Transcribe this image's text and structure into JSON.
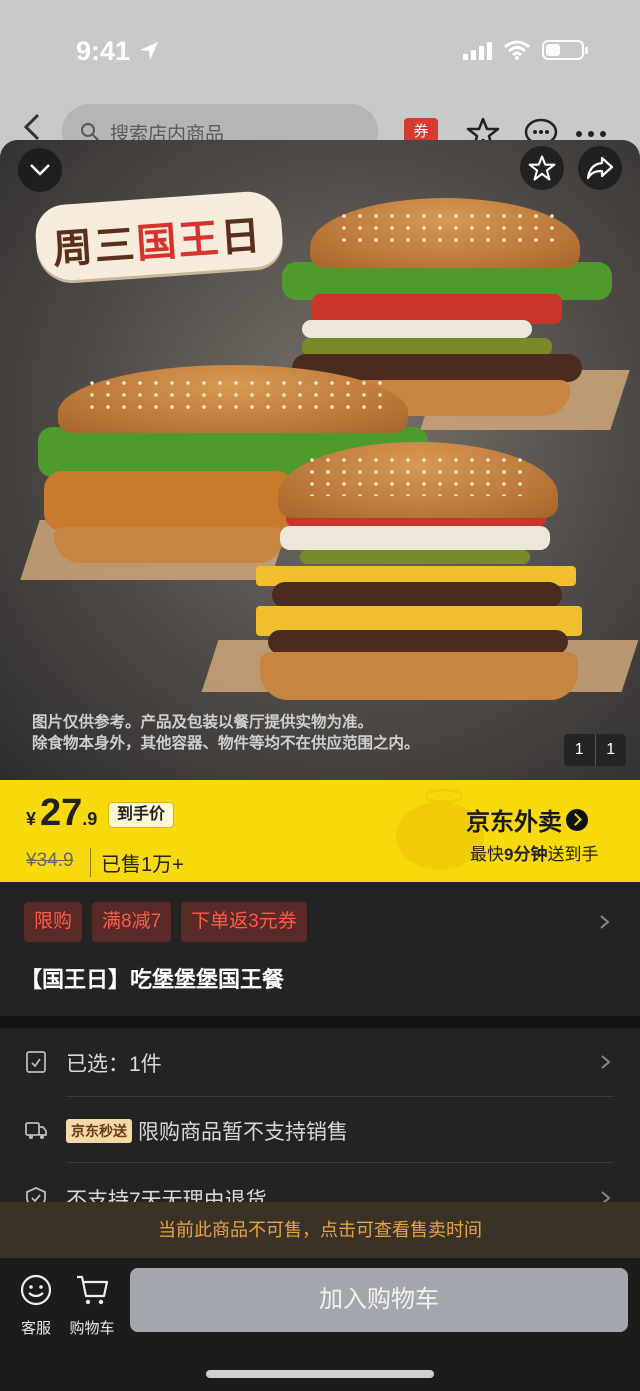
{
  "status_bar": {
    "time": "9:41"
  },
  "header": {
    "search_placeholder": "搜索店内商品",
    "coupon_label": "券"
  },
  "hero": {
    "promo_title_part1": "周三",
    "promo_title_highlight": "国王",
    "promo_title_part2": "日",
    "disclaimer_line1": "图片仅供参考。产品及包装以餐厅提供实物为准。",
    "disclaimer_line2": "除食物本身外，其他容器、物件等均不在供应范围之内。",
    "pager_current": "1",
    "pager_total": "1"
  },
  "price": {
    "currency": "¥",
    "integer": "27",
    "decimal": ".9",
    "final_tag": "到手价",
    "original": "¥34.9",
    "sold": "已售1万+"
  },
  "brand": {
    "name": "京东外卖",
    "sub_prefix": "最快",
    "sub_minutes": "9分钟",
    "sub_suffix": "送到手"
  },
  "info": {
    "chips": [
      "限购",
      "满8减7",
      "下单返3元券"
    ],
    "title": "【国王日】吃堡堡堡国王餐"
  },
  "rows": {
    "selected": "已选：1件",
    "delivery_tag": "京东秒送",
    "delivery_text": "限购商品暂不支持销售",
    "return_policy": "不支持7天无理由退货"
  },
  "notice": "当前此商品不可售，点击可查看售卖时间",
  "footer": {
    "service_label": "客服",
    "cart_label": "购物车",
    "add_to_cart": "加入购物车"
  },
  "colors": {
    "price_bar": "#f8d90b",
    "chip_text": "#ff5a4a",
    "notice_text": "#e6a447",
    "add_button": "#a3a6ac"
  }
}
